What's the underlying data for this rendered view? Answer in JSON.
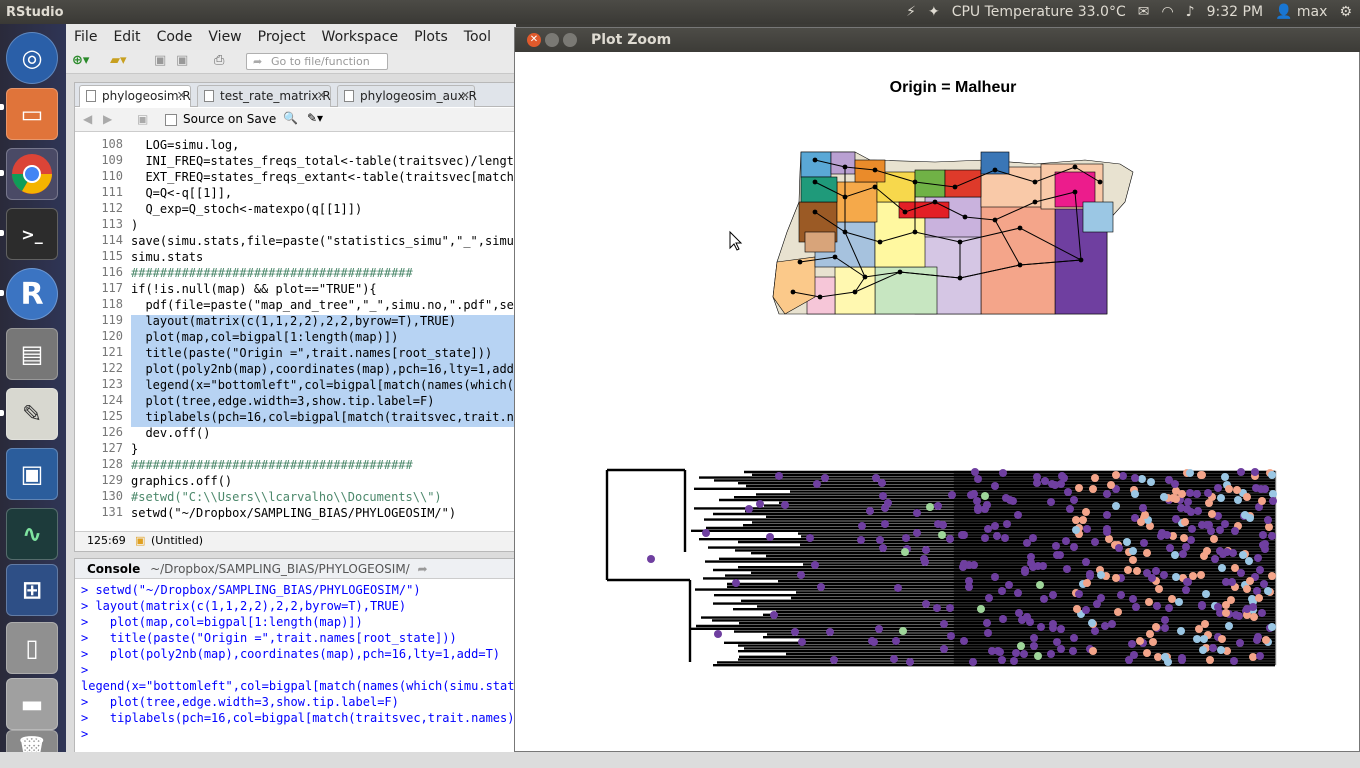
{
  "topbar": {
    "app_title": "RStudio",
    "cpu_temp": "CPU Temperature 33.0°C",
    "time": "9:32 PM",
    "user": "max"
  },
  "launcher": {
    "items": [
      "ubuntu-dash",
      "files",
      "chrome",
      "terminal",
      "rstudio",
      "scanner",
      "text-editor",
      "virtualbox",
      "system-monitor",
      "workspace-switcher",
      "usb-drive",
      "disk-drive",
      "trash"
    ]
  },
  "rstudio": {
    "menu": [
      "File",
      "Edit",
      "Code",
      "View",
      "Project",
      "Workspace",
      "Plots",
      "Tool"
    ],
    "goto_placeholder": "Go to file/function",
    "tabs": [
      "phylogeosim.R",
      "test_rate_matrix.R",
      "phylogeosim_aux.R"
    ],
    "source_on_save": "Source on Save",
    "code_lines": [
      {
        "n": "108",
        "t": "  LOG=simu.log,"
      },
      {
        "n": "109",
        "t": "  INI_FREQ=states_freqs_total<-table(traitsvec)/length("
      },
      {
        "n": "110",
        "t": "  EXT_FREQ=states_freqs_extant<-table(traitsvec[match(t"
      },
      {
        "n": "111",
        "t": "  Q=Q<-q[[1]],"
      },
      {
        "n": "112",
        "t": "  Q_exp=Q_stoch<-matexpo(q[[1]])"
      },
      {
        "n": "113",
        "t": ")"
      },
      {
        "n": "114",
        "t": "save(simu.stats,file=paste(\"statistics_simu\",\"_\",simu.n"
      },
      {
        "n": "115",
        "t": "simu.stats"
      },
      {
        "n": "116",
        "t": "#######################################"
      },
      {
        "n": "117",
        "t": "if(!is.null(map) && plot==\"TRUE\"){"
      },
      {
        "n": "118",
        "t": "  pdf(file=paste(\"map_and_tree\",\"_\",simu.no,\".pdf\",sep="
      },
      {
        "n": "119",
        "t": "  layout(matrix(c(1,1,2,2),2,2,byrow=T),TRUE)"
      },
      {
        "n": "120",
        "t": "  plot(map,col=bigpal[1:length(map)])"
      },
      {
        "n": "121",
        "t": "  title(paste(\"Origin =\",trait.names[root_state]))"
      },
      {
        "n": "122",
        "t": "  plot(poly2nb(map),coordinates(map),pch=16,lty=1,add=T"
      },
      {
        "n": "123",
        "t": "  legend(x=\"bottomleft\",col=bigpal[match(names(which(si"
      },
      {
        "n": "124",
        "t": "  plot(tree,edge.width=3,show.tip.label=F)"
      },
      {
        "n": "125",
        "t": "  tiplabels(pch=16,col=bigpal[match(traitsvec,trait.nam"
      },
      {
        "n": "126",
        "t": "  dev.off()"
      },
      {
        "n": "127",
        "t": "}"
      },
      {
        "n": "128",
        "t": "#######################################"
      },
      {
        "n": "129",
        "t": "graphics.off()"
      },
      {
        "n": "130",
        "t": "#setwd(\"C:\\\\Users\\\\lcarvalho\\\\Documents\\\\\")"
      },
      {
        "n": "131",
        "t": "setwd(\"~/Dropbox/SAMPLING_BIAS/PHYLOGEOSIM/\")"
      }
    ],
    "cursor_pos": "125:69",
    "scope": "(Untitled)",
    "console_title": "Console",
    "console_path": "~/Dropbox/SAMPLING_BIAS/PHYLOGEOSIM/",
    "console_lines": [
      "> setwd(\"~/Dropbox/SAMPLING_BIAS/PHYLOGEOSIM/\")",
      "> layout(matrix(c(1,1,2,2),2,2,byrow=T),TRUE)",
      ">   plot(map,col=bigpal[1:length(map)])",
      ">   title(paste(\"Origin =\",trait.names[root_state]))",
      ">   plot(poly2nb(map),coordinates(map),pch=16,lty=1,add=T)",
      ">",
      "legend(x=\"bottomleft\",col=bigpal[match(names(which(simu.stats$",
      ">   plot(tree,edge.width=3,show.tip.label=F)",
      ">   tiplabels(pch=16,col=bigpal[match(traitsvec,trait.names)],",
      "> "
    ]
  },
  "plot_zoom": {
    "window_title": "Plot Zoom",
    "plot_title": "Origin = Malheur",
    "tip_colors": [
      "#6f3fa0",
      "#f4a58a",
      "#9bc7e4",
      "#9fd69a"
    ]
  }
}
